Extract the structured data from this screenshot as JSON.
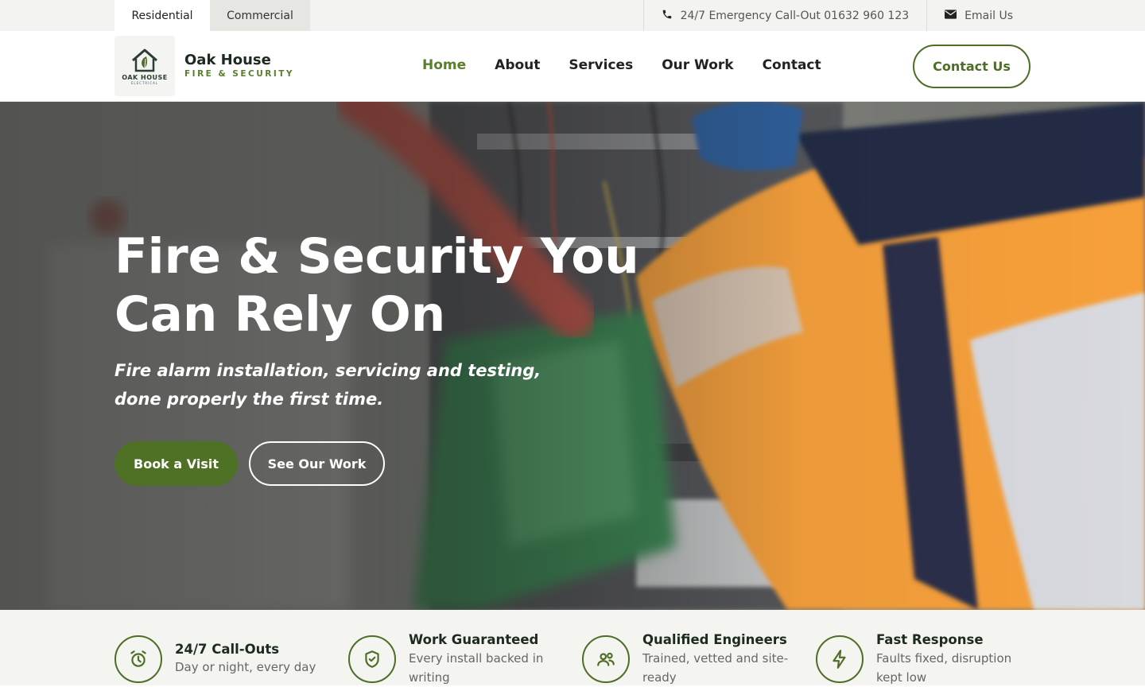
{
  "topbar": {
    "tab_residential": "Residential",
    "tab_commercial": "Commercial",
    "emergency_label": "24/7 Emergency Call-Out 01632 960 123",
    "email_label": "Email Us",
    "phone_icon": "phone-icon",
    "mail_icon": "mail-icon"
  },
  "brand": {
    "logo_line1": "OAK HOUSE",
    "logo_line2": "ELECTRICAL",
    "name": "Oak House",
    "tagline": "FIRE & SECURITY"
  },
  "nav": {
    "items": [
      {
        "label": "Home",
        "active": true
      },
      {
        "label": "About",
        "active": false
      },
      {
        "label": "Services",
        "active": false
      },
      {
        "label": "Our Work",
        "active": false
      },
      {
        "label": "Contact",
        "active": false
      }
    ],
    "cta_label": "Contact Us"
  },
  "hero": {
    "title_line1": "Fire & Security You",
    "title_line2": "Can Rely On",
    "subtitle": "Fire alarm installation, servicing and testing, done properly the first time.",
    "primary_button": "Book a Visit",
    "secondary_button": "See Our Work"
  },
  "features": [
    {
      "icon": "alarm-clock-icon",
      "title": "24/7 Call-Outs",
      "desc": "Day or night, every day"
    },
    {
      "icon": "shield-check-icon",
      "title": "Work Guaranteed",
      "desc": "Every install backed in writing"
    },
    {
      "icon": "users-icon",
      "title": "Qualified Engineers",
      "desc": "Trained, vetted and site-ready"
    },
    {
      "icon": "lightning-icon",
      "title": "Fast Response",
      "desc": "Faults fixed, disruption kept low"
    }
  ],
  "colors": {
    "accent": "#5a7d2e",
    "accent_dark": "#4e6e26",
    "topbar_bg": "#f3f3f1",
    "features_bg": "#f4f4f1"
  }
}
